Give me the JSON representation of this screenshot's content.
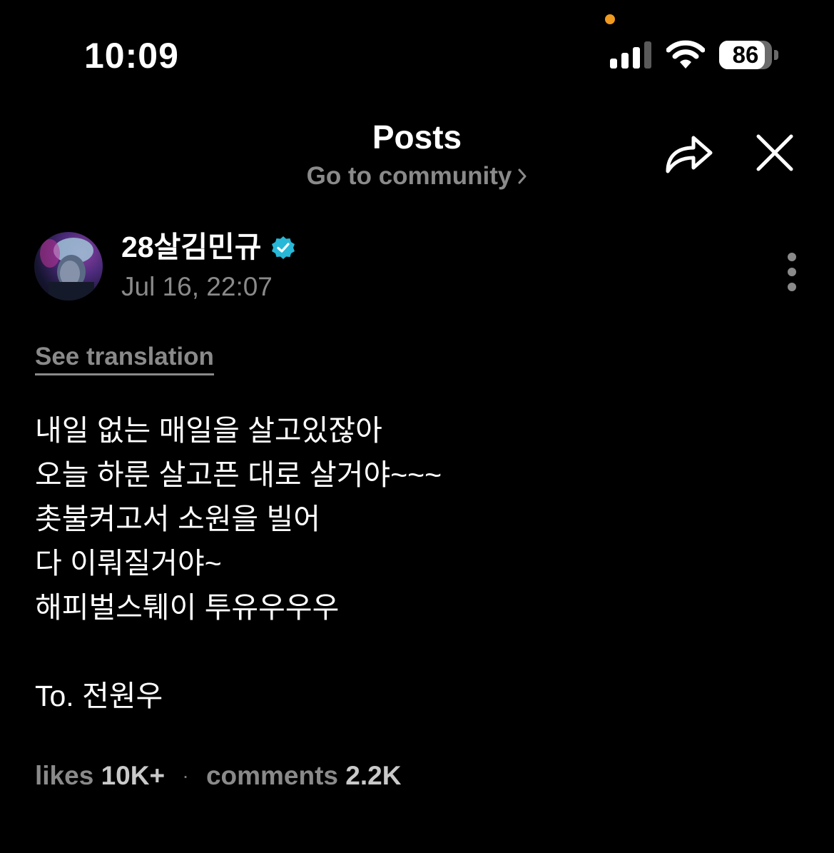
{
  "status_bar": {
    "time": "10:09",
    "battery_level": "86"
  },
  "header": {
    "title": "Posts",
    "community_link": "Go to community"
  },
  "post": {
    "author_name": "28살김민규",
    "verified": true,
    "timestamp": "Jul 16, 22:07",
    "see_translation": "See translation",
    "body_lines": [
      "내일 없는 매일을 살고있잖아",
      "오늘 하룬 살고픈 대로 살거야~~~",
      "촛불켜고서 소원을 빌어",
      "다 이뤄질거야~",
      "해피벌스퉤이 투유우우우",
      "",
      "To. 전원우"
    ],
    "likes_label": "likes",
    "likes_count": "10K+",
    "comments_label": "comments",
    "comments_count": "2.2K"
  },
  "colors": {
    "background": "#000000",
    "text": "#ffffff",
    "muted": "#8a8a8a",
    "verified": "#27b8d8",
    "privacy_dot": "#f09a1f"
  }
}
